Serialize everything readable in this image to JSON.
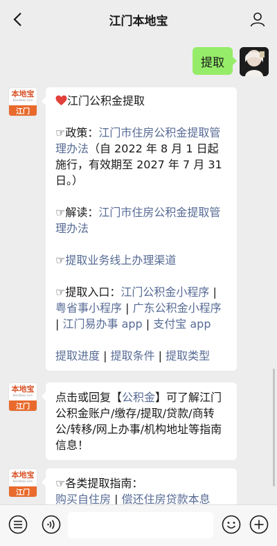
{
  "header": {
    "title": "江门本地宝"
  },
  "outgoing": {
    "text": "提取"
  },
  "bot": {
    "avatar_name": "本地宝",
    "avatar_url": "Bendibao.com",
    "avatar_city": "江门"
  },
  "msg1": {
    "heading_icon": "heart-icon",
    "heading": "江门公积金提取",
    "pointer": "☞",
    "policy_label": "政策：",
    "policy_link": "江门市住房公积金提取管理办法",
    "policy_note": "（自 2022 年 8 月 1 日起施行，有效期至 2027 年 7 月 31 日。）",
    "interpret_label": "解读：",
    "interpret_link": "江门市住房公积金提取管理办法",
    "online_link": "提取业务线上办理渠道",
    "entry_label": "提取入口：",
    "entries": [
      "江门公积金小程序",
      "粤省事小程序",
      "广东公积金小程序",
      "江门易办事 app",
      "支付宝 app"
    ],
    "sep": " | ",
    "bottom_links": [
      "提取进度",
      "提取条件",
      "提取类型"
    ]
  },
  "msg2": {
    "pre": "点击或回复【",
    "link": "公积金",
    "post": "】可了解江门公积金账户/缴存/提取/贷款/商转公/转移/网上办事/机构地址等指南信息！"
  },
  "msg3": {
    "label": "各类提取指南：",
    "links": [
      "购买自住房",
      "偿还住房贷款本息"
    ]
  }
}
